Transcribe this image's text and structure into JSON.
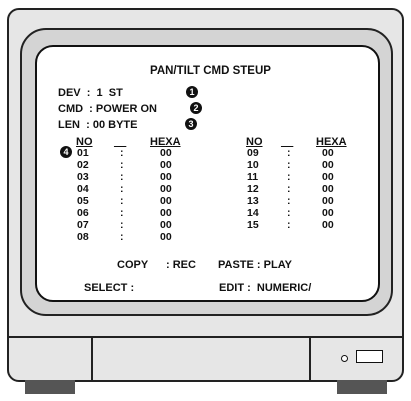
{
  "screen": {
    "title": "PAN/TILT CMD STEUP",
    "dev_line": "DEV  :  1  ST",
    "cmd_line": "CMD  : POWER ON",
    "len_line": "LEN  : 00 BYTE",
    "badges": [
      "1",
      "2",
      "3",
      "4"
    ],
    "table": {
      "headers": {
        "no": "NO",
        "dash": "__",
        "hexa": "HEXA"
      },
      "left": {
        "no": [
          "01",
          "02",
          "03",
          "04",
          "05",
          "06",
          "07",
          "08"
        ],
        "hexa": [
          "00",
          "00",
          "00",
          "00",
          "00",
          "00",
          "00",
          "00"
        ]
      },
      "right": {
        "no": [
          "09",
          "10",
          "11",
          "12",
          "13",
          "14",
          "15"
        ],
        "hexa": [
          "00",
          "00",
          "00",
          "00",
          "00",
          "00",
          "00"
        ]
      }
    },
    "copy_label": "COPY",
    "copy_value": ": REC",
    "paste_label": "PASTE : PLAY",
    "select_label": "SELECT :",
    "edit_label": "EDIT :  NUMERIC/"
  }
}
